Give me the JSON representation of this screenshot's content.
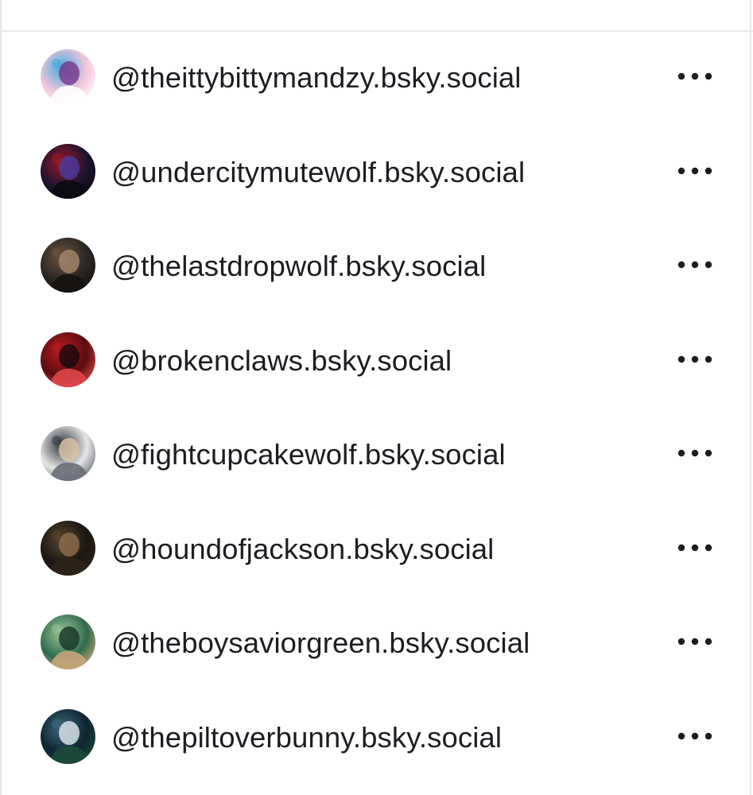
{
  "followers": [
    {
      "handle": "@theittybittymandzy.bsky.social",
      "avatar_icon": "avatar-pink-blue-anime-icon",
      "colors": [
        "#f4c6d9",
        "#3fa9e0",
        "#7a3b8f",
        "#ffffff"
      ]
    },
    {
      "handle": "@undercitymutewolf.bsky.social",
      "avatar_icon": "avatar-dark-red-purple-icon",
      "colors": [
        "#1c1430",
        "#a0182a",
        "#4a3a9a",
        "#0a0a12"
      ]
    },
    {
      "handle": "@thelastdropwolf.bsky.social",
      "avatar_icon": "avatar-bearded-man-icon",
      "colors": [
        "#2a2622",
        "#6b5444",
        "#a0826a",
        "#151311"
      ]
    },
    {
      "handle": "@brokenclaws.bsky.social",
      "avatar_icon": "avatar-red-dark-icon",
      "colors": [
        "#5a0c10",
        "#c01c24",
        "#1a0a0c",
        "#e0464a"
      ]
    },
    {
      "handle": "@fightcupcakewolf.bsky.social",
      "avatar_icon": "avatar-grey-drawn-girl-icon",
      "colors": [
        "#e6e6e6",
        "#2b2f3a",
        "#d9c3a8",
        "#6a6e78"
      ]
    },
    {
      "handle": "@houndofjackson.bsky.social",
      "avatar_icon": "avatar-man-guitar-icon",
      "colors": [
        "#1a1612",
        "#5a4630",
        "#8a6a4a",
        "#2e241a"
      ]
    },
    {
      "handle": "@theboysaviorgreen.bsky.social",
      "avatar_icon": "avatar-green-elf-icon",
      "colors": [
        "#2f6b4a",
        "#9cc89a",
        "#1b3a2a",
        "#c9a57a"
      ]
    },
    {
      "handle": "@thepiltoverbunny.bsky.social",
      "avatar_icon": "avatar-bunny-character-icon",
      "colors": [
        "#0f2430",
        "#3d6a80",
        "#d8e0e6",
        "#1d4a3a"
      ]
    }
  ],
  "more_icon": "more-horizontal-icon",
  "text_color": "#1a1d21",
  "divider_color": "#e6e8eb"
}
